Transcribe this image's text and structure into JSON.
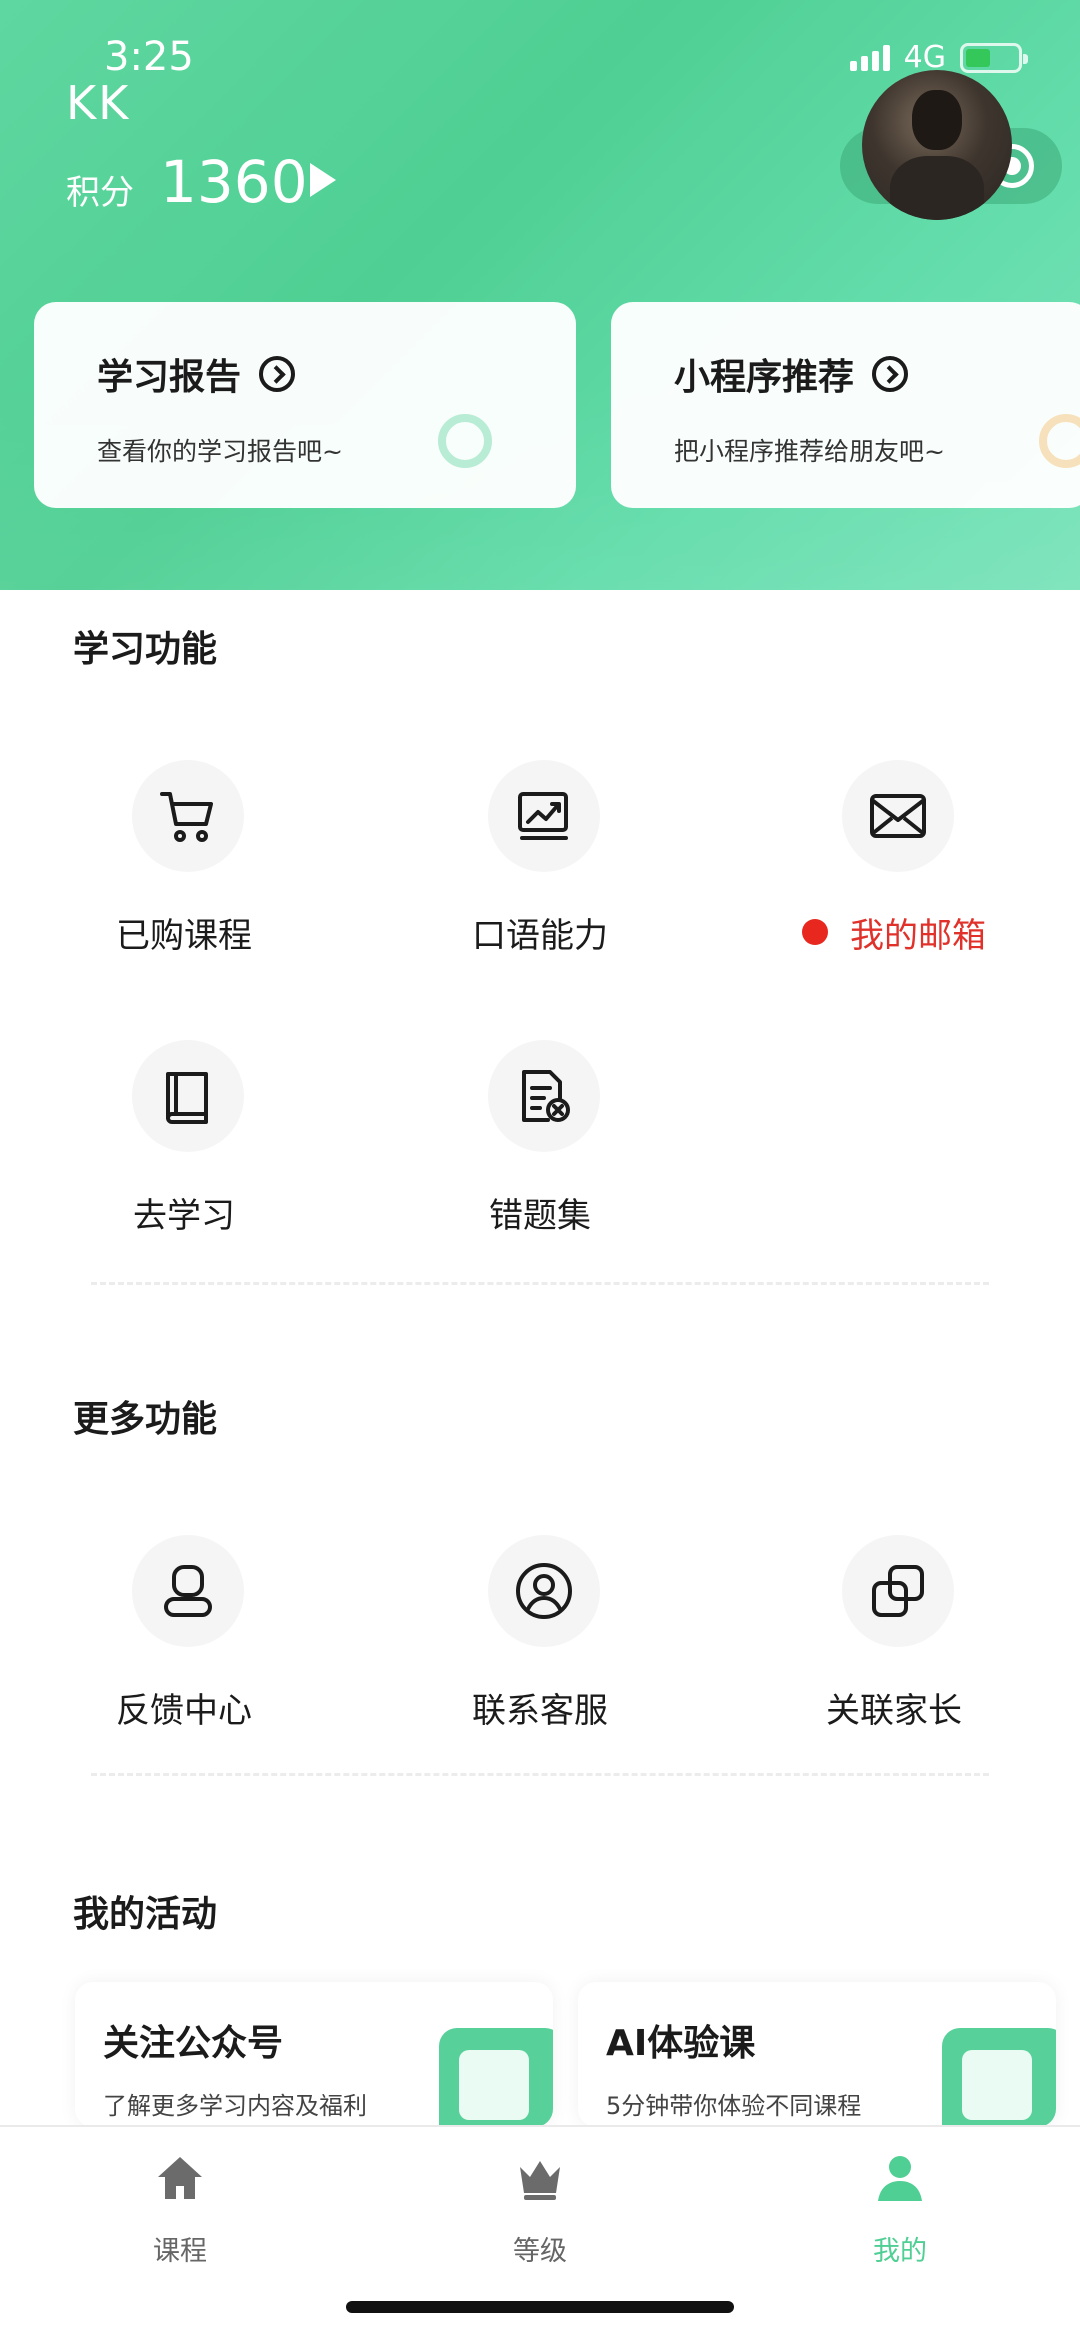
{
  "status_bar": {
    "time": "3:25",
    "network": "4G"
  },
  "profile": {
    "name": "KK",
    "points_label": "积分",
    "points_value": "1360"
  },
  "cards": [
    {
      "title": "学习报告",
      "subtitle": "查看你的学习报告吧~"
    },
    {
      "title": "小程序推荐",
      "subtitle": "把小程序推荐给朋友吧~"
    }
  ],
  "study_section": {
    "title": "学习功能",
    "items": [
      {
        "label": "已购课程",
        "icon": "cart-icon"
      },
      {
        "label": "口语能力",
        "icon": "trend-chart-icon"
      },
      {
        "label": "我的邮箱",
        "icon": "mail-icon",
        "unread": true
      },
      {
        "label": "去学习",
        "icon": "book-icon"
      },
      {
        "label": "错题集",
        "icon": "wrong-questions-icon"
      }
    ]
  },
  "more_section": {
    "title": "更多功能",
    "items": [
      {
        "label": "反馈中心",
        "icon": "feedback-icon"
      },
      {
        "label": "联系客服",
        "icon": "user-circle-icon"
      },
      {
        "label": "关联家长",
        "icon": "link-copy-icon"
      }
    ]
  },
  "activities": {
    "title": "我的活动",
    "items": [
      {
        "title": "关注公众号",
        "subtitle": "了解更多学习内容及福利"
      },
      {
        "title": "AI体验课",
        "subtitle": "5分钟带你体验不同课程"
      }
    ]
  },
  "tabbar": {
    "active": "我的",
    "tabs": [
      {
        "label": "课程",
        "icon": "home-icon"
      },
      {
        "label": "等级",
        "icon": "crown-icon"
      },
      {
        "label": "我的",
        "icon": "person-icon"
      }
    ]
  },
  "colors": {
    "brand_green": "#4fcf93",
    "alert_red": "#e8271e"
  }
}
